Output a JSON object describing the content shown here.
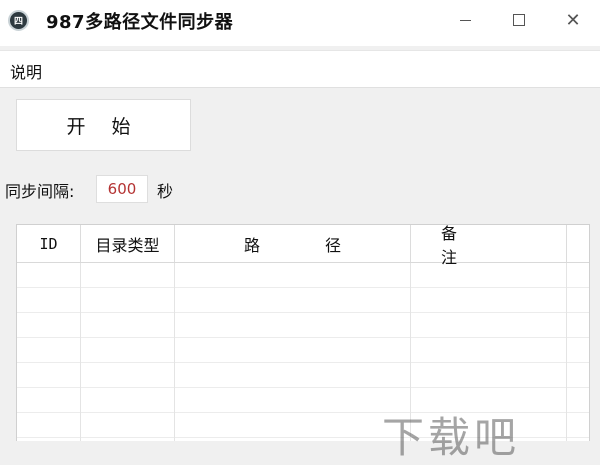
{
  "window": {
    "title": "987多路径文件同步器",
    "app_icon_text": "四"
  },
  "menu": {
    "items": [
      {
        "label": "说明"
      }
    ]
  },
  "controls": {
    "start_label": "开 始",
    "interval_label": "同步间隔:",
    "interval_value": "600",
    "interval_unit": "秒"
  },
  "table": {
    "columns": [
      "ID",
      "目录类型",
      "路 径",
      "备 注"
    ],
    "rows": []
  },
  "watermark": {
    "text": "下载吧"
  },
  "colors": {
    "interval_value": "#b43333",
    "background": "#f0f0f0"
  }
}
